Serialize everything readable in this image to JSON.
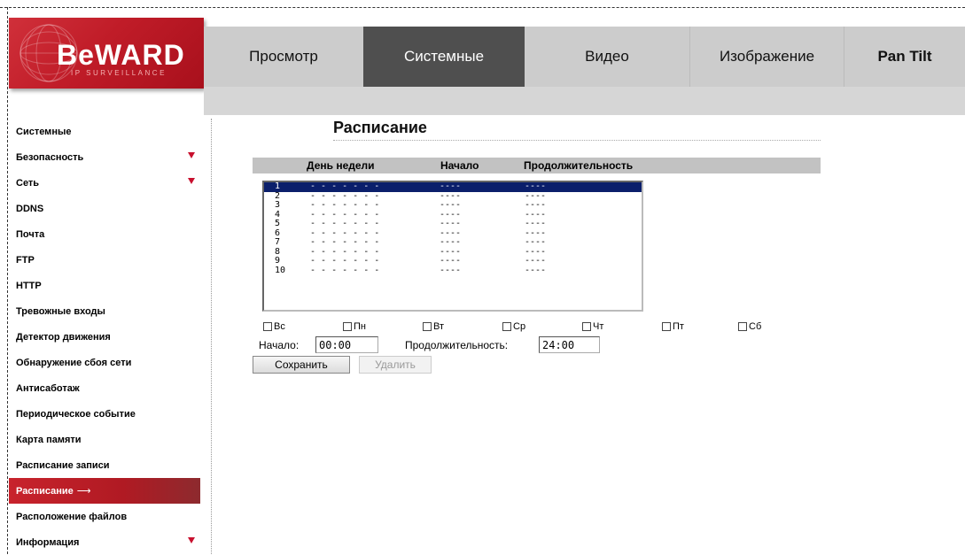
{
  "brand": {
    "name": "BeWARD",
    "tagline": "IP SURVEILLANCE"
  },
  "tabs": [
    {
      "label": "Просмотр"
    },
    {
      "label": "Системные"
    },
    {
      "label": "Видео"
    },
    {
      "label": "Изображение"
    },
    {
      "label": "Pan Tilt"
    }
  ],
  "sidebar": {
    "items": [
      {
        "label": "Системные"
      },
      {
        "label": "Безопасность"
      },
      {
        "label": "Сеть"
      },
      {
        "label": "DDNS"
      },
      {
        "label": "Почта"
      },
      {
        "label": "FTP"
      },
      {
        "label": "HTTP"
      },
      {
        "label": "Тревожные входы"
      },
      {
        "label": "Детектор движения"
      },
      {
        "label": "Обнаружение сбоя сети"
      },
      {
        "label": "Антисаботаж"
      },
      {
        "label": "Периодическое событие"
      },
      {
        "label": "Карта памяти"
      },
      {
        "label": "Расписание записи"
      },
      {
        "label": "Расписание",
        "arrow": "⟶"
      },
      {
        "label": "Расположение файлов"
      },
      {
        "label": "Информация"
      }
    ]
  },
  "page": {
    "title": "Расписание"
  },
  "table": {
    "columns": [
      "День недели",
      "Начало",
      "Продолжительность"
    ],
    "rows": [
      {
        "num": "1",
        "days": "- - - - - - -",
        "start": "----",
        "duration": "----"
      },
      {
        "num": "2",
        "days": "- - - - - - -",
        "start": "----",
        "duration": "----"
      },
      {
        "num": "3",
        "days": "- - - - - - -",
        "start": "----",
        "duration": "----"
      },
      {
        "num": "4",
        "days": "- - - - - - -",
        "start": "----",
        "duration": "----"
      },
      {
        "num": "5",
        "days": "- - - - - - -",
        "start": "----",
        "duration": "----"
      },
      {
        "num": "6",
        "days": "- - - - - - -",
        "start": "----",
        "duration": "----"
      },
      {
        "num": "7",
        "days": "- - - - - - -",
        "start": "----",
        "duration": "----"
      },
      {
        "num": "8",
        "days": "- - - - - - -",
        "start": "----",
        "duration": "----"
      },
      {
        "num": "9",
        "days": "- - - - - - -",
        "start": "----",
        "duration": "----"
      },
      {
        "num": "10",
        "days": "- - - - - - -",
        "start": "----",
        "duration": "----"
      }
    ]
  },
  "weekdays": [
    "Вс",
    "Пн",
    "Вт",
    "Ср",
    "Чт",
    "Пт",
    "Сб"
  ],
  "form": {
    "start_label": "Начало:",
    "start_value": "00:00",
    "duration_label": "Продолжительность:",
    "duration_value": "24:00"
  },
  "buttons": {
    "save": "Сохранить",
    "delete": "Удалить"
  },
  "colors": {
    "accent": "#c8232c",
    "selection": "#0b1f6b",
    "active_tab": "#4f4f4f"
  }
}
